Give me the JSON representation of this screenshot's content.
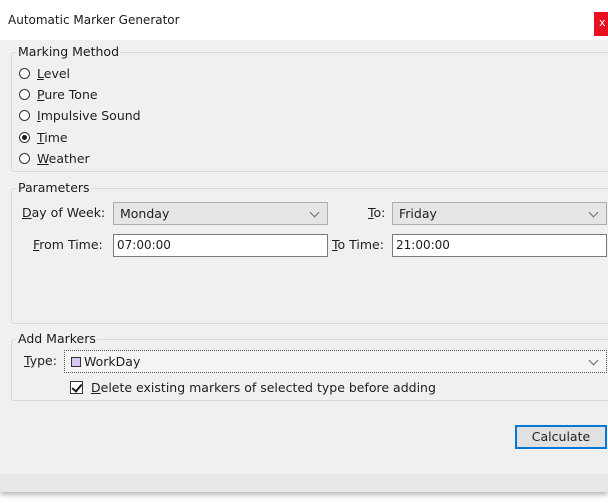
{
  "window": {
    "title": "Automatic Marker Generator",
    "close_glyph": "x"
  },
  "marking_method": {
    "legend": "Marking Method",
    "options": [
      {
        "label": "Level",
        "mnemonic": "L",
        "rest": "evel",
        "checked": false
      },
      {
        "label": "Pure Tone",
        "mnemonic": "P",
        "rest": "ure Tone",
        "checked": false
      },
      {
        "label": "Impulsive Sound",
        "mnemonic": "I",
        "rest": "mpulsive Sound",
        "checked": false
      },
      {
        "label": "Time",
        "mnemonic": "T",
        "rest": "ime",
        "checked": true
      },
      {
        "label": "Weather",
        "mnemonic": "W",
        "rest": "eather",
        "checked": false
      }
    ]
  },
  "parameters": {
    "legend": "Parameters",
    "day_of_week": {
      "mnemonic": "D",
      "rest": "ay of Week:",
      "value": "Monday"
    },
    "to": {
      "mnemonic": "T",
      "rest": "o:",
      "value": "Friday"
    },
    "from_time": {
      "mnemonic": "F",
      "rest": "rom Time:",
      "value": "07:00:00"
    },
    "to_time": {
      "mnemonic": "T",
      "rest": "o Time:",
      "value": "21:00:00"
    }
  },
  "add_markers": {
    "legend": "Add Markers",
    "type": {
      "mnemonic": "T",
      "rest": "ype:",
      "value": "WorkDay",
      "swatch_color": "#d7c7f4"
    },
    "delete_existing": {
      "mnemonic": "D",
      "rest": "elete existing markers of selected type before adding",
      "checked": true
    }
  },
  "actions": {
    "calculate": "Calculate"
  }
}
